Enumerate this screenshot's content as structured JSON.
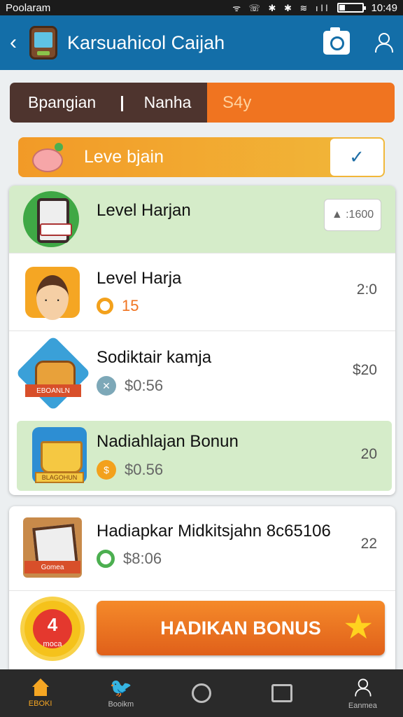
{
  "status_bar": {
    "carrier": "Poolaram",
    "icons": "ᯤ ☏ ✱ ✱ ≋ ıll",
    "time": "10:49"
  },
  "header": {
    "title": "Karsuahicol Caijah",
    "back_icon": "chevron-left-icon",
    "camera_icon": "camera-icon",
    "profile_icon": "person-icon"
  },
  "segment_bar": {
    "left_label": "Bpangian",
    "separator": "|",
    "middle_label": "Nanha",
    "right_label": "S4y"
  },
  "level_banner": {
    "label": "Leve bjain",
    "action": "✓"
  },
  "rows": [
    {
      "title": "Level Harjan",
      "badge": "▲ :1600"
    },
    {
      "title": "Level Harja",
      "sub_value": "15",
      "value": "2:0"
    },
    {
      "title": "Sodiktair kamja",
      "sub_value": "$0:56",
      "value": "$20",
      "ribbon": "EBOANLN"
    },
    {
      "title": "Nadiahlajan Bonun",
      "sub_value": "$0.56",
      "value": "20",
      "ribbon": "BLAGOHUN"
    }
  ],
  "second_card": {
    "row": {
      "title": "Hadiapkar Midkitsjahn 8c65106",
      "sub_value": "$8:06",
      "value": "22",
      "ribbon": "Gomea"
    },
    "sun_label": "4",
    "sun_sub": "moca",
    "bonus_button": "HADIKAN BONUS",
    "star": "★"
  },
  "bottom_nav": [
    {
      "label": "EBOKI",
      "icon": "home-icon"
    },
    {
      "label": "Booikm",
      "icon": "bird-icon",
      "glyph": "🐦"
    },
    {
      "label": "",
      "icon": "circle-icon"
    },
    {
      "label": "",
      "icon": "square-icon"
    },
    {
      "label": "Eanmea",
      "icon": "user-icon"
    }
  ],
  "colors": {
    "header": "#136ea8",
    "accent_orange": "#f07420",
    "highlight_green": "#d5ecc9",
    "nav_active": "#f5a623"
  }
}
